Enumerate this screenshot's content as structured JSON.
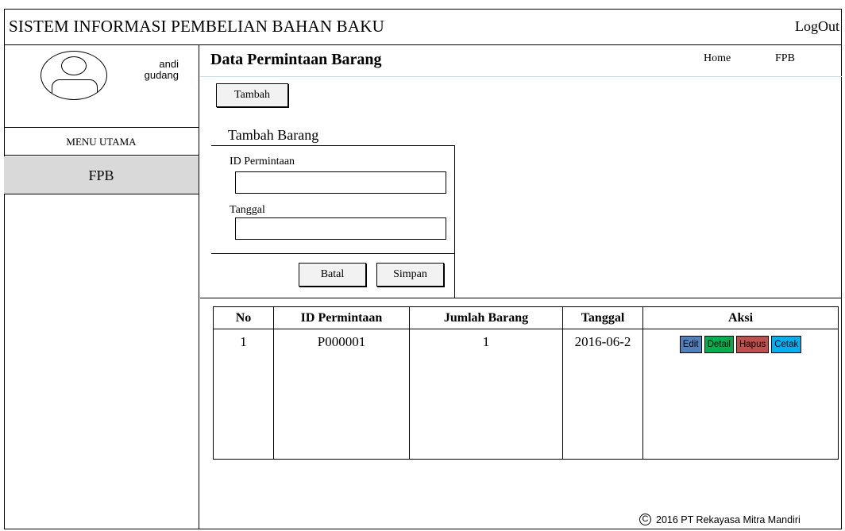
{
  "app": {
    "title": "SISTEM INFORMASI PEMBELIAN BAHAN BAKU",
    "logout_label": "LogOut"
  },
  "sidebar": {
    "user_first": "andi",
    "user_second": "gudang",
    "menu_header": "MENU UTAMA",
    "items": [
      {
        "label": "FPB"
      }
    ]
  },
  "header": {
    "page_title": "Data Permintaan Barang",
    "nav": [
      {
        "label": "Home"
      },
      {
        "label": "FPB"
      }
    ]
  },
  "toolbar": {
    "tambah_label": "Tambah"
  },
  "form": {
    "title": "Tambah Barang",
    "id_label": "ID Permintaan",
    "id_value": "",
    "tanggal_label": "Tanggal",
    "tanggal_value": "",
    "batal_label": "Batal",
    "simpan_label": "Simpan"
  },
  "table": {
    "columns": [
      "No",
      "ID Permintaan",
      "Jumlah Barang",
      "Tanggal",
      "Aksi"
    ],
    "rows": [
      {
        "no": "1",
        "id": "P000001",
        "jumlah": "1",
        "tanggal": "2016-06-2",
        "actions": [
          {
            "label": "Edit"
          },
          {
            "label": "Detail"
          },
          {
            "label": "Hapus"
          },
          {
            "label": "Cetak"
          }
        ]
      }
    ]
  },
  "action_colors": {
    "edit": "#4f81bd",
    "detail": "#00b050",
    "hapus": "#c0504d",
    "cetak": "#00b0f0"
  },
  "accent_colors": {
    "menu_active_bg": "#d9d9d9",
    "title_underline": "#bfe0ea"
  },
  "footer": {
    "copyright_symbol": "C",
    "text": "2016 PT Rekayasa Mitra Mandiri"
  }
}
